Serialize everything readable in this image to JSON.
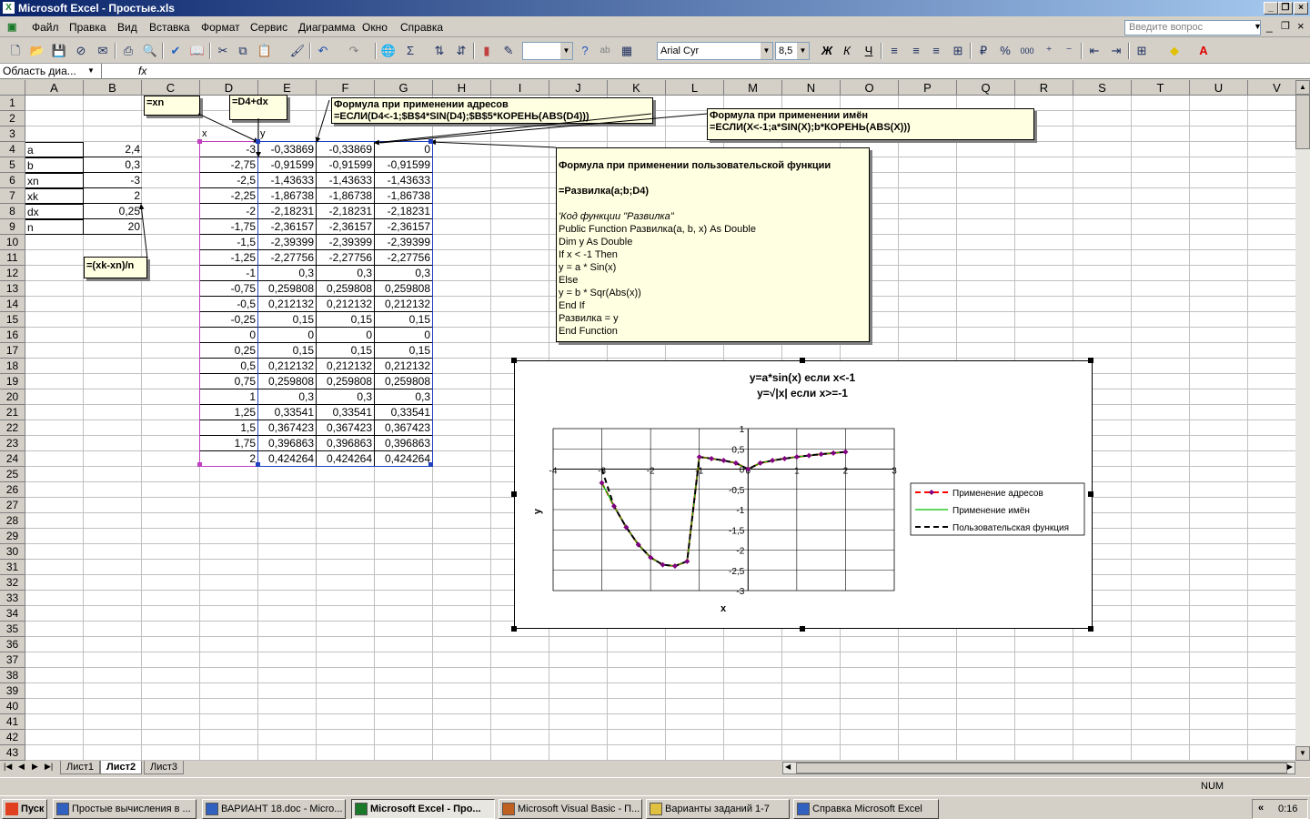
{
  "window": {
    "title": "Microsoft Excel - Простые.xls"
  },
  "menu": [
    "Файл",
    "Правка",
    "Вид",
    "Вставка",
    "Формат",
    "Сервис",
    "Диаграмма",
    "Окно",
    "Справка"
  ],
  "ask_placeholder": "Введите вопрос",
  "font": {
    "name": "Arial Cyr",
    "size": "8,5"
  },
  "namebox": "Область диа...",
  "fx_label": "fx",
  "columns": [
    "A",
    "B",
    "C",
    "D",
    "E",
    "F",
    "G",
    "H",
    "I",
    "J",
    "K",
    "L",
    "M",
    "N",
    "O",
    "P",
    "Q",
    "R",
    "S",
    "T",
    "U",
    "V"
  ],
  "params": [
    [
      "a",
      "2,4"
    ],
    [
      "b",
      "0,3"
    ],
    [
      "xn",
      "-3"
    ],
    [
      "xk",
      "2"
    ],
    [
      "dx",
      "0,25"
    ],
    [
      "n",
      "20"
    ]
  ],
  "header_x": "x",
  "header_y": "y",
  "table": [
    [
      "-3",
      "-0,33869",
      "-0,33869",
      "0"
    ],
    [
      "-2,75",
      "-0,91599",
      "-0,91599",
      "-0,91599"
    ],
    [
      "-2,5",
      "-1,43633",
      "-1,43633",
      "-1,43633"
    ],
    [
      "-2,25",
      "-1,86738",
      "-1,86738",
      "-1,86738"
    ],
    [
      "-2",
      "-2,18231",
      "-2,18231",
      "-2,18231"
    ],
    [
      "-1,75",
      "-2,36157",
      "-2,36157",
      "-2,36157"
    ],
    [
      "-1,5",
      "-2,39399",
      "-2,39399",
      "-2,39399"
    ],
    [
      "-1,25",
      "-2,27756",
      "-2,27756",
      "-2,27756"
    ],
    [
      "-1",
      "0,3",
      "0,3",
      "0,3"
    ],
    [
      "-0,75",
      "0,259808",
      "0,259808",
      "0,259808"
    ],
    [
      "-0,5",
      "0,212132",
      "0,212132",
      "0,212132"
    ],
    [
      "-0,25",
      "0,15",
      "0,15",
      "0,15"
    ],
    [
      "0",
      "0",
      "0",
      "0"
    ],
    [
      "0,25",
      "0,15",
      "0,15",
      "0,15"
    ],
    [
      "0,5",
      "0,212132",
      "0,212132",
      "0,212132"
    ],
    [
      "0,75",
      "0,259808",
      "0,259808",
      "0,259808"
    ],
    [
      "1",
      "0,3",
      "0,3",
      "0,3"
    ],
    [
      "1,25",
      "0,33541",
      "0,33541",
      "0,33541"
    ],
    [
      "1,5",
      "0,367423",
      "0,367423",
      "0,367423"
    ],
    [
      "1,75",
      "0,396863",
      "0,396863",
      "0,396863"
    ],
    [
      "2",
      "0,424264",
      "0,424264",
      "0,424264"
    ]
  ],
  "notes": {
    "xn": "=xn",
    "d4dx": "=D4+dx",
    "addr_title": "Формула при применении адресов",
    "addr_formula": "=ЕСЛИ(D4<-1;$B$4*SIN(D4);$B$5*КОРЕНЬ(ABS(D4)))",
    "names_title": "Формула при применении имён",
    "names_formula": "=ЕСЛИ(X<-1;a*SIN(X);b*КОРЕНЬ(ABS(X)))",
    "dx": "=(xk-xn)/n",
    "udf_lines": [
      "Формула при применении пользовательской функции",
      "",
      "=Развилка(a;b;D4)",
      "",
      "'Код функции \"Развилка\"",
      "Public Function Развилка(a, b, x) As Double",
      "Dim y As Double",
      "If x < -1 Then",
      "  y = a * Sin(x)",
      "Else",
      "  y = b * Sqr(Abs(x))",
      "End If",
      "Развилка = y",
      "End Function"
    ]
  },
  "tabs": [
    "Лист1",
    "Лист2",
    "Лист3"
  ],
  "status_num": "NUM",
  "taskbar": {
    "start": "Пуск",
    "tasks": [
      "Простые вычисления в ...",
      "ВАРИАНТ 18.doc - Micro...",
      "Microsoft Excel - Про...",
      "Microsoft Visual Basic - П...",
      "Варианты заданий 1-7",
      "Справка Microsoft Excel"
    ],
    "time": "0:16"
  },
  "chart_data": {
    "type": "line",
    "title_lines": [
      "y=a*sin(x)    если x<-1",
      "y=√|x|    если x>=-1"
    ],
    "xlabel": "x",
    "ylabel": "y",
    "xlim": [
      -4,
      3
    ],
    "ylim": [
      -3,
      1
    ],
    "xticks": [
      "-4",
      "-3",
      "-2",
      "-1",
      "0",
      "1",
      "2",
      "3"
    ],
    "yticks": [
      "1",
      "0,5",
      "0",
      "-0,5",
      "-1",
      "-1,5",
      "-2",
      "-2,5",
      "-3"
    ],
    "x": [
      -3,
      -2.75,
      -2.5,
      -2.25,
      -2,
      -1.75,
      -1.5,
      -1.25,
      -1,
      -0.75,
      -0.5,
      -0.25,
      0,
      0.25,
      0.5,
      0.75,
      1,
      1.25,
      1.5,
      1.75,
      2
    ],
    "series": [
      {
        "name": "Применение адресов",
        "color": "#ff0000",
        "values": [
          -0.33869,
          -0.91599,
          -1.43633,
          -1.86738,
          -2.18231,
          -2.36157,
          -2.39399,
          -2.27756,
          0.3,
          0.259808,
          0.212132,
          0.15,
          0,
          0.15,
          0.212132,
          0.259808,
          0.3,
          0.33541,
          0.367423,
          0.396863,
          0.424264
        ]
      },
      {
        "name": "Применение имён",
        "color": "#00c000",
        "values": [
          -0.33869,
          -0.91599,
          -1.43633,
          -1.86738,
          -2.18231,
          -2.36157,
          -2.39399,
          -2.27756,
          0.3,
          0.259808,
          0.212132,
          0.15,
          0,
          0.15,
          0.212132,
          0.259808,
          0.3,
          0.33541,
          0.367423,
          0.396863,
          0.424264
        ]
      },
      {
        "name": "Пользовательская функция",
        "color": "#000000",
        "values": [
          0,
          -0.91599,
          -1.43633,
          -1.86738,
          -2.18231,
          -2.36157,
          -2.39399,
          -2.27756,
          0.3,
          0.259808,
          0.212132,
          0.15,
          0,
          0.15,
          0.212132,
          0.259808,
          0.3,
          0.33541,
          0.367423,
          0.396863,
          0.424264
        ]
      }
    ],
    "legend": "right",
    "marker_color": "#800080",
    "grid": true
  }
}
